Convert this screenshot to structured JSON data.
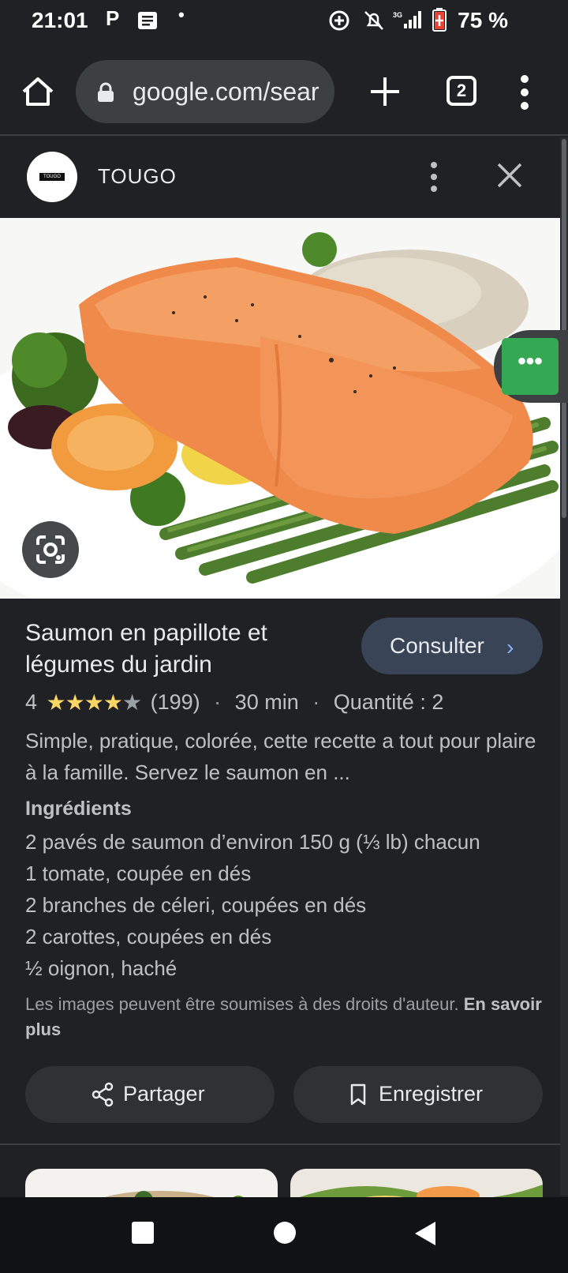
{
  "status_bar": {
    "time": "21:01",
    "battery": "75 %"
  },
  "browser": {
    "url": "google.com/sear",
    "tab_count": "2"
  },
  "panel": {
    "source_name": "TOUGO",
    "logo_text": "TOUGO"
  },
  "recipe": {
    "title": "Saumon en papillote et légumes du jardin",
    "consult_label": "Consulter",
    "rating": "4",
    "rating_value": 4,
    "rating_max": 5,
    "reviews": "(199)",
    "time": "30 min",
    "quantity": "Quantité : 2",
    "description": "Simple, pratique, colorée, cette recette a tout pour plaire à la famille. Servez le saumon en ...",
    "ingredients_heading": "Ingrédients",
    "ingredients": [
      "2 pavés de saumon d’environ 150 g (⅓ lb) chacun",
      "1 tomate, coupée en dés",
      "2 branches de céleri, coupées en dés",
      "2 carottes, coupées en dés",
      "½ oignon, haché"
    ],
    "copyright_text": "Les images peuvent être soumises à des droits d'auteur.",
    "copyright_link": "En savoir plus"
  },
  "actions": {
    "share_label": "Partager",
    "save_label": "Enregistrer"
  },
  "icons": {
    "home": "home-icon",
    "lock": "lock-icon",
    "plus": "plus-icon",
    "menu": "more-vert-icon",
    "close": "close-icon",
    "lens": "lens-icon",
    "share": "share-icon",
    "bookmark": "bookmark-icon"
  },
  "colors": {
    "background": "#202124",
    "button_bg": "#303134",
    "consult_bg": "#394457",
    "accent_blue": "#8ab4f8",
    "star": "#fdd663",
    "float_green": "#34a853"
  }
}
